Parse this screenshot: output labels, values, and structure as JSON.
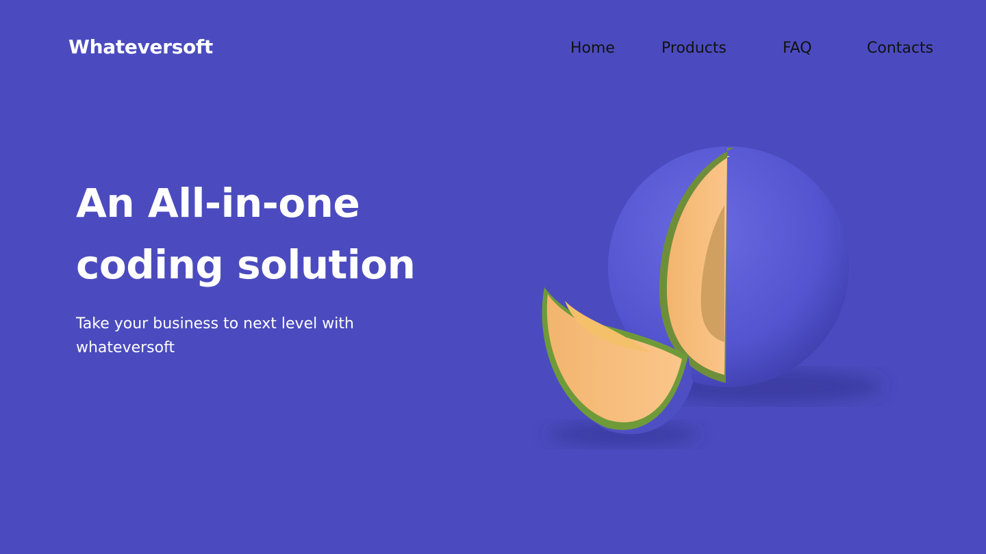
{
  "header": {
    "logo": "Whateversoft",
    "nav": [
      "Home",
      "Products",
      "FAQ",
      "Contacts"
    ]
  },
  "hero": {
    "title_line1": "An All-in-one",
    "title_line2": "coding solution",
    "subtitle": "Take your business to next level with whateversoft"
  },
  "colors": {
    "background": "#4b4bbf",
    "melon_rind": "#5a5ad6",
    "melon_flesh": "#f7b877"
  }
}
